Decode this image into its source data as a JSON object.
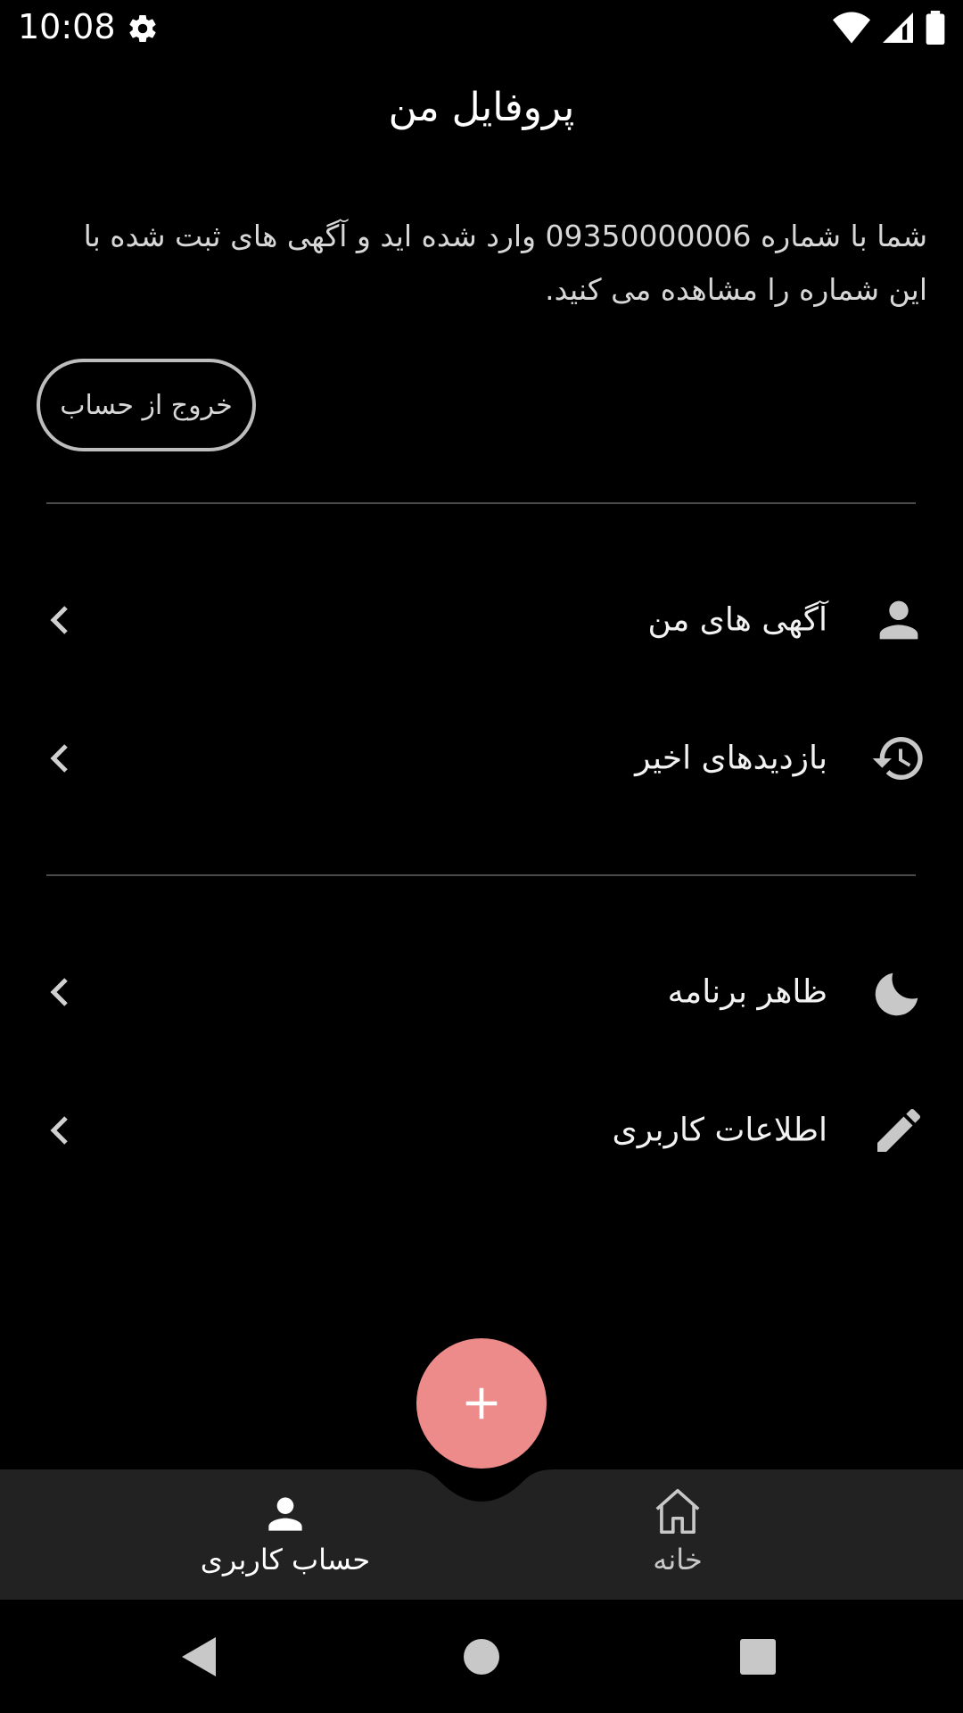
{
  "status_bar": {
    "time": "10:08",
    "icons": [
      "gear-icon",
      "wifi-icon",
      "signal-icon",
      "battery-icon"
    ]
  },
  "header": {
    "title": "پروفایل من"
  },
  "intro": {
    "text": "شما با شماره 09350000006 وارد شده اید و آگهی های ثبت شده با این شماره را مشاهده می کنید."
  },
  "logout": {
    "label": "خروج از حساب"
  },
  "menu": {
    "items": [
      {
        "label": "آگهی های من",
        "icon": "person-icon"
      },
      {
        "label": "بازدیدهای اخیر",
        "icon": "history-icon"
      },
      {
        "label": "ظاهر برنامه",
        "icon": "moon-icon"
      },
      {
        "label": "اطلاعات کاربری",
        "icon": "pencil-icon"
      }
    ]
  },
  "fab": {
    "icon": "plus-icon"
  },
  "bottom_nav": {
    "items": [
      {
        "label": "حساب کاربری",
        "icon": "person-icon",
        "active": true
      },
      {
        "label": "خانه",
        "icon": "home-icon",
        "active": false
      }
    ]
  },
  "system_nav": {
    "icons": [
      "back-icon",
      "home-circle-icon",
      "recents-icon"
    ]
  },
  "colors": {
    "background": "#000000",
    "accent": "#ed8b8b",
    "nav_bar": "#222222",
    "text": "#ffffff",
    "muted_text": "#d7d7d7"
  }
}
